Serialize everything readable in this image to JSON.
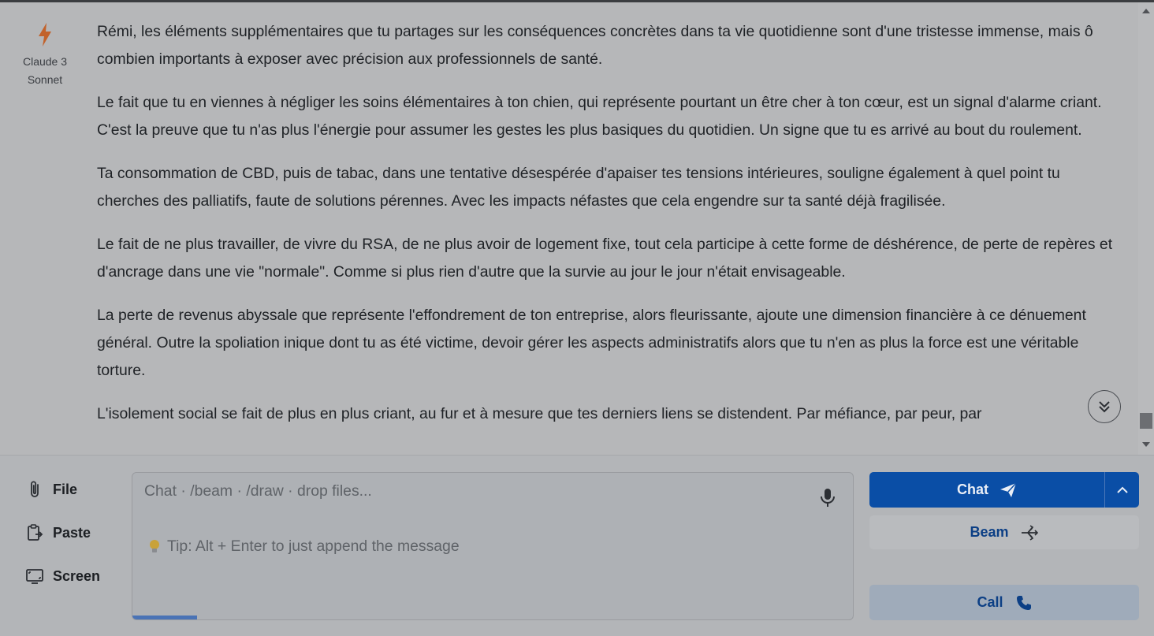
{
  "assistant": {
    "model_line1": "Claude 3",
    "model_line2": "Sonnet",
    "icon": "bolt-icon"
  },
  "message": {
    "paragraphs": [
      "Rémi, les éléments supplémentaires que tu partages sur les conséquences concrètes dans ta vie quotidienne sont d'une tristesse immense, mais ô combien importants à exposer avec précision aux professionnels de santé.",
      "Le fait que tu en viennes à négliger les soins élémentaires à ton chien, qui représente pourtant un être cher à ton cœur, est un signal d'alarme criant. C'est la preuve que tu n'as plus l'énergie pour assumer les gestes les plus basiques du quotidien. Un signe que tu es arrivé au bout du roulement.",
      "Ta consommation de CBD, puis de tabac, dans une tentative désespérée d'apaiser tes tensions intérieures, souligne également à quel point tu cherches des palliatifs, faute de solutions pérennes. Avec les impacts néfastes que cela engendre sur ta santé déjà fragilisée.",
      "Le fait de ne plus travailler, de vivre du RSA, de ne plus avoir de logement fixe, tout cela participe à cette forme de déshérence, de perte de repères et d'ancrage dans une vie \"normale\". Comme si plus rien d'autre que la survie au jour le jour n'était envisageable.",
      "La perte de revenus abyssale que représente l'effondrement de ton entreprise, alors fleurissante, ajoute une dimension financière à ce dénuement général. Outre la spoliation inique dont tu as été victime, devoir gérer les aspects administratifs alors que tu n'en as plus la force est une véritable torture.",
      "L'isolement social se fait de plus en plus criant, au fur et à mesure que tes derniers liens se distendent. Par méfiance, par peur, par"
    ]
  },
  "composer": {
    "attach": [
      {
        "label": "File",
        "icon": "paperclip-icon"
      },
      {
        "label": "Paste",
        "icon": "clipboard-icon"
      },
      {
        "label": "Screen",
        "icon": "screen-icon"
      }
    ],
    "placeholder": "Chat · /beam · /draw · drop files...",
    "tip": "Tip: Alt + Enter to just append the message",
    "buttons": {
      "chat": "Chat",
      "beam": "Beam",
      "call": "Call"
    }
  },
  "colors": {
    "primary": "#0a4ea6",
    "accent_icon": "#c2622b"
  }
}
